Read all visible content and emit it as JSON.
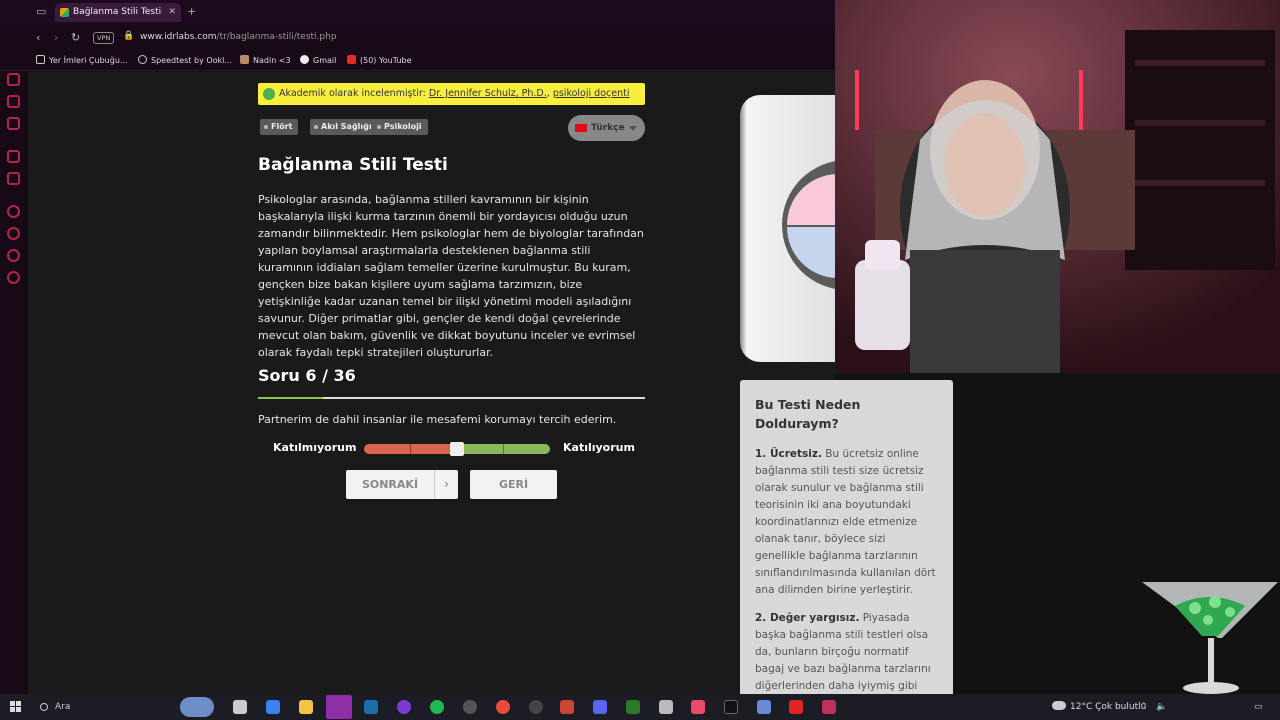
{
  "browser": {
    "tab_title": "Bağlanma Stili Testi",
    "vpn_label": "VPN",
    "url_host": "www.idrlabs.com",
    "url_path": "/tr/baglanma-stili/testi.php",
    "bookmarks": [
      "Yer İmleri Çubuğu...",
      "Speedtest by Ookl...",
      "Nadin <3",
      "Gmail",
      "(50) YouTube"
    ]
  },
  "page": {
    "review_prefix": "Akademik olarak incelenmiştir: ",
    "review_author": "Dr. Jennifer Schulz, Ph.D.",
    "review_sep": ", ",
    "review_role": "psikoloji doçenti",
    "tags": [
      "Flört",
      "Akıl Sağlığı",
      "Psikoloji"
    ],
    "language": "Türkçe",
    "title": "Bağlanma Stili Testi",
    "intro": "Psikologlar arasında, bağlanma stilleri kavramının bir kişinin başkalarıyla ilişki kurma tarzının önemli bir yordayıcısı olduğu uzun zamandır bilinmektedir. Hem psikologlar hem de biyologlar tarafından yapılan boylamsal araştırmalarla desteklenen bağlanma stili kuramının iddiaları sağlam temeller üzerine kurulmuştur. Bu kuram, gençken bize bakan kişilere uyum sağlama tarzımızın, bize yetişkinliğe kadar uzanan temel bir ilişki yönetimi modeli aşıladığını savunur. Diğer primatlar gibi, gençler de kendi doğal çevrelerinde mevcut olan bakım, güvenlik ve dikkat boyutunu inceler ve evrimsel olarak faydalı tepki stratejileri oluştururlar.",
    "question_counter": "Soru 6 / 36",
    "progress": 0.167,
    "question": "Partnerim de dahil insanlar ile mesafemi korumayı tercih ederim.",
    "scale_left": "Katılmıyorum",
    "scale_right": "Katılıyorum",
    "scale_value": 0.5,
    "next_label": "SONRAKİ",
    "next_arrow": "›",
    "back_label": "GERİ"
  },
  "sidebar_box": {
    "title": "Bu Testi Neden Dolduraym?",
    "items": [
      {
        "lead": "1. Ücretsiz.",
        "text": " Bu ücretsiz online bağlanma stili testi size ücretsiz olarak sunulur ve bağlanma stili teorisinin iki ana boyutundaki koordinatlarınızı elde etmenize olanak tanır, böylece sizi genellikle bağlanma tarzlarının sınıflandırılmasında kullanılan dört ana dilimden birine yerleştirir."
      },
      {
        "lead": "2. Değer yargısız.",
        "text": " Piyasada başka bağlanma stili testleri olsa da, bunların birçoğu normatif bagaj ve bazı bağlanma tarzlarını diğerlerinden daha iyiymiş gibi"
      }
    ]
  },
  "taskbar": {
    "search_placeholder": "Ara",
    "weather": "12°C  Çok bulutlu"
  },
  "colors": {
    "accent_green": "#8bc34a",
    "review_yellow": "#f7ee3d",
    "scale_red": "#d9654f",
    "scale_green": "#8bb85a"
  }
}
